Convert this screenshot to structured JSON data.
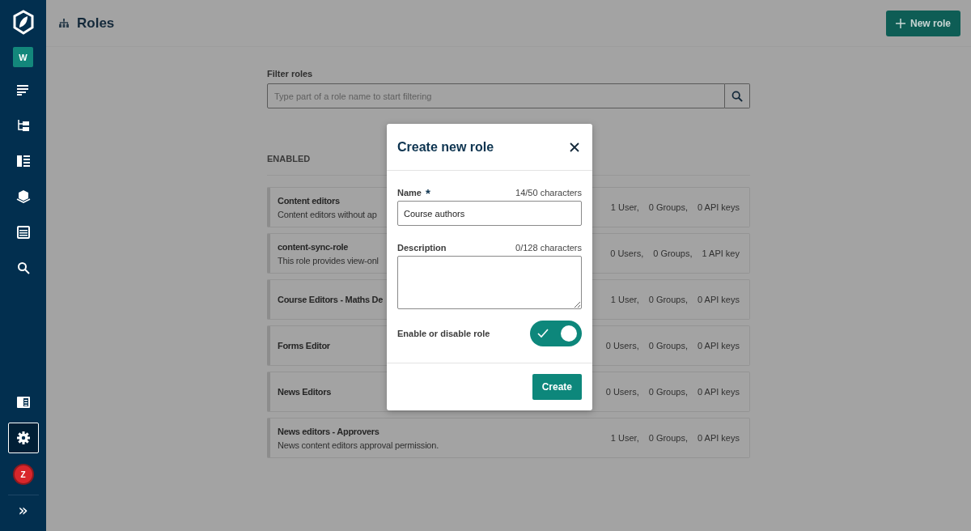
{
  "sidebar": {
    "workspace_badge": "W",
    "items": [
      {
        "kind": "list",
        "selected": false
      },
      {
        "kind": "tree",
        "selected": false
      },
      {
        "kind": "columns",
        "selected": false
      },
      {
        "kind": "cube",
        "selected": false
      },
      {
        "kind": "table",
        "selected": false
      },
      {
        "kind": "search",
        "selected": false
      },
      {
        "kind": "panel",
        "selected": false
      },
      {
        "kind": "settings",
        "selected": true
      }
    ],
    "user_avatar": "Z",
    "expand": "»"
  },
  "header": {
    "title": "Roles",
    "new_button": "New role"
  },
  "filter": {
    "label": "Filter roles",
    "placeholder": "Type part of a role name to start filtering"
  },
  "section_title": "ENABLED",
  "roles": [
    {
      "name": "Content editors",
      "description": "Content editors without ap",
      "users": "1 User,",
      "groups": "0 Groups,",
      "api_keys": "0 API keys"
    },
    {
      "name": "content-sync-role",
      "description": "This role provides view-onl",
      "users": "0 Users,",
      "groups": "0 Groups,",
      "api_keys": "1 API key"
    },
    {
      "name": "Course Editors - Maths De",
      "users": "1 User,",
      "groups": "0 Groups,",
      "api_keys": "0 API keys"
    },
    {
      "name": "Forms Editor",
      "users": "0 Users,",
      "groups": "0 Groups,",
      "api_keys": "0 API keys"
    },
    {
      "name": "News Editors",
      "users": "0 Users,",
      "groups": "0 Groups,",
      "api_keys": "0 API keys"
    },
    {
      "name": "News editors - Approvers",
      "description": "News content editors approval permission.",
      "users": "1 User,",
      "groups": "0 Groups,",
      "api_keys": "0 API keys"
    }
  ],
  "modal": {
    "title": "Create new role",
    "name_label": "Name",
    "required_mark": "*",
    "name_counter": "14/50 characters",
    "name_value": "Course authors",
    "description_label": "Description",
    "description_counter": "0/128 characters",
    "toggle_label": "Enable or disable role",
    "enabled": true,
    "create_button": "Create"
  }
}
